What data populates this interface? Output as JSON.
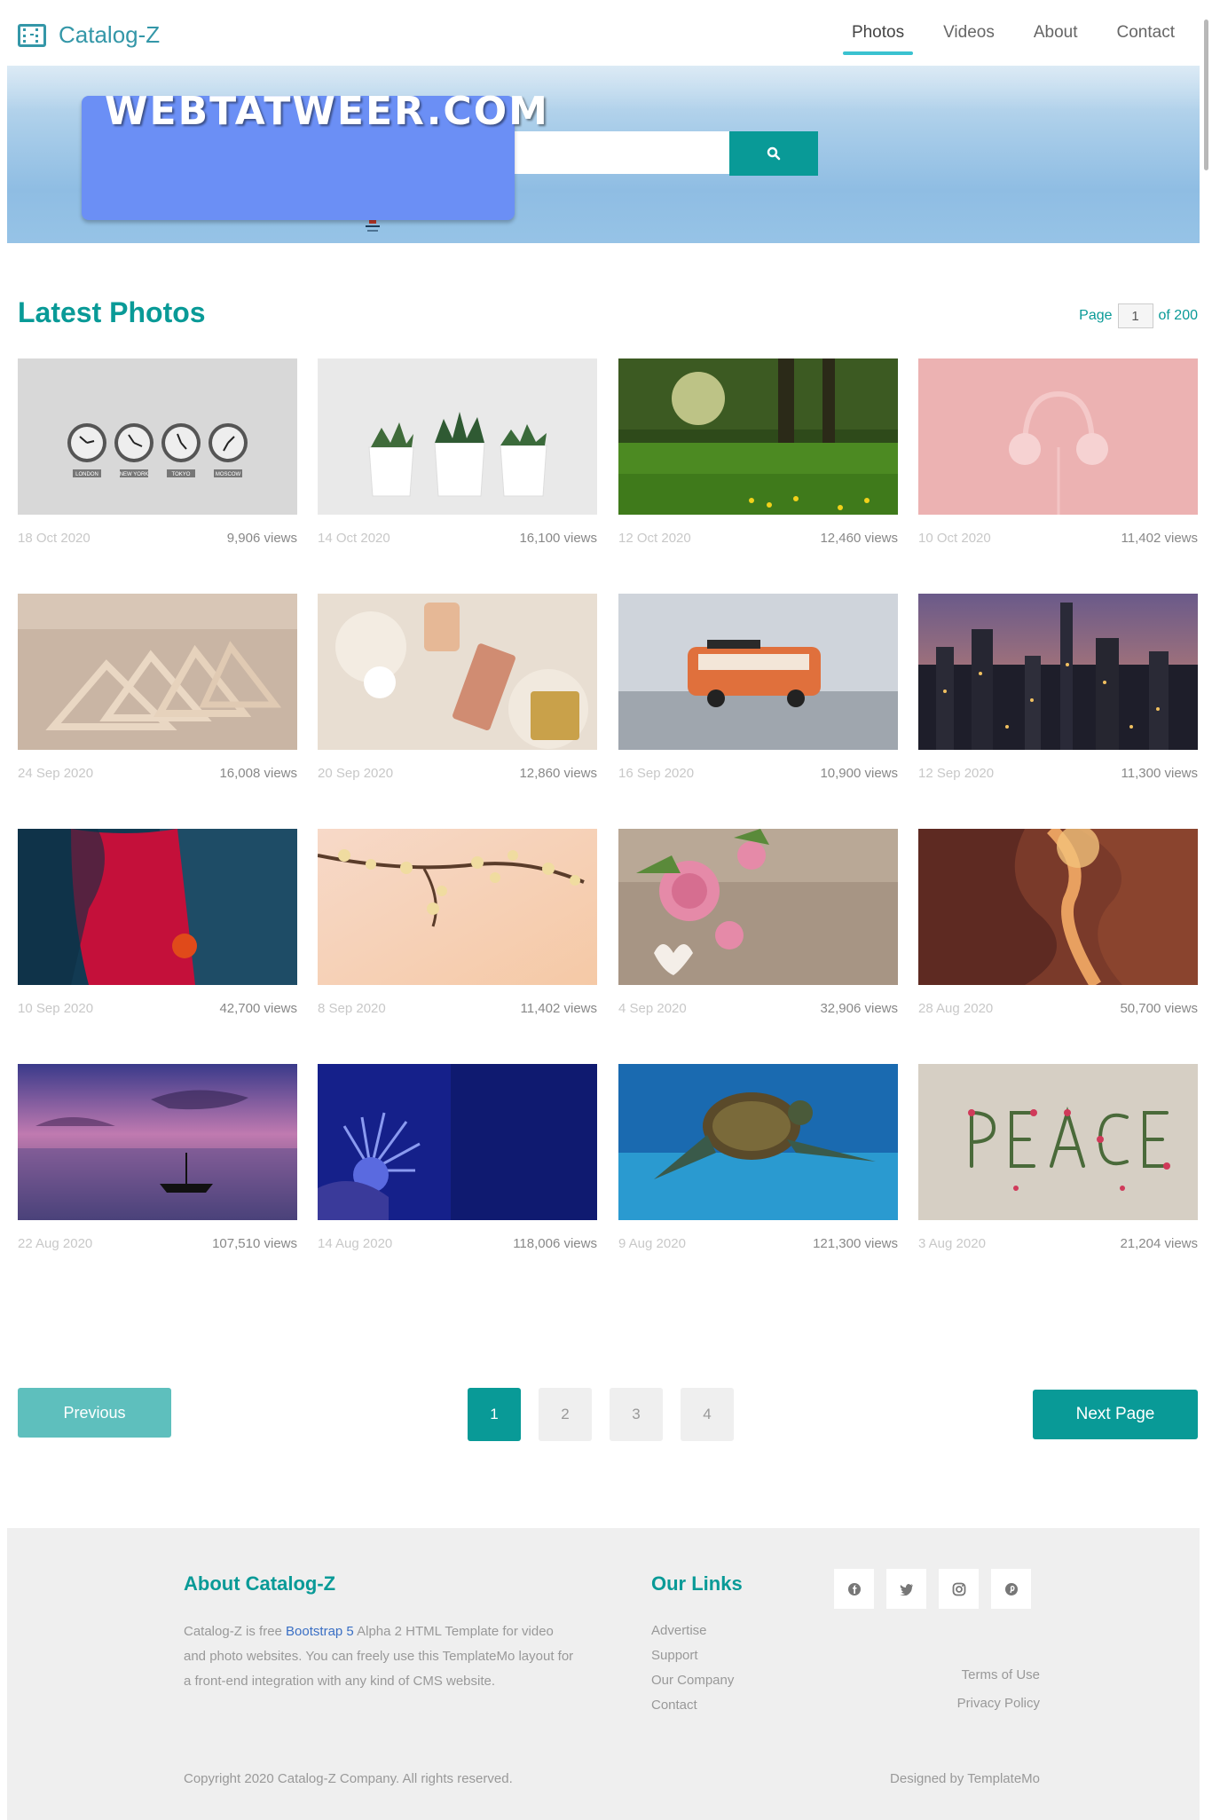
{
  "brand": {
    "name": "Catalog-Z"
  },
  "nav": [
    "Photos",
    "Videos",
    "About",
    "Contact"
  ],
  "hero": {
    "overlay_text": "WEBTATWEER.COM",
    "search_placeholder": ""
  },
  "section": {
    "title": "Latest Photos",
    "page_label": "Page",
    "page_value": "1",
    "page_of": "of 200"
  },
  "photos": [
    {
      "date": "18 Oct 2020",
      "views": "9,906 views"
    },
    {
      "date": "14 Oct 2020",
      "views": "16,100 views"
    },
    {
      "date": "12 Oct 2020",
      "views": "12,460 views"
    },
    {
      "date": "10 Oct 2020",
      "views": "11,402 views"
    },
    {
      "date": "24 Sep 2020",
      "views": "16,008 views"
    },
    {
      "date": "20 Sep 2020",
      "views": "12,860 views"
    },
    {
      "date": "16 Sep 2020",
      "views": "10,900 views"
    },
    {
      "date": "12 Sep 2020",
      "views": "11,300 views"
    },
    {
      "date": "10 Sep 2020",
      "views": "42,700 views"
    },
    {
      "date": "8 Sep 2020",
      "views": "11,402 views"
    },
    {
      "date": "4 Sep 2020",
      "views": "32,906 views"
    },
    {
      "date": "28 Aug 2020",
      "views": "50,700 views"
    },
    {
      "date": "22 Aug 2020",
      "views": "107,510 views"
    },
    {
      "date": "14 Aug 2020",
      "views": "118,006 views"
    },
    {
      "date": "9 Aug 2020",
      "views": "121,300 views"
    },
    {
      "date": "3 Aug 2020",
      "views": "21,204 views"
    }
  ],
  "clock_labels": [
    "LONDON",
    "NEW YORK",
    "TOKYO",
    "MOSCOW"
  ],
  "pagination": {
    "previous": "Previous",
    "pages": [
      "1",
      "2",
      "3",
      "4"
    ],
    "next": "Next Page"
  },
  "footer": {
    "about_title": "About Catalog-Z",
    "about_pre": "Catalog-Z is free ",
    "about_link": "Bootstrap 5",
    "about_post": " Alpha 2 HTML Template for video and photo websites. You can freely use this TemplateMo layout for a front-end integration with any kind of CMS website.",
    "links_title": "Our Links",
    "links": [
      "Advertise",
      "Support",
      "Our Company",
      "Contact"
    ],
    "terms": "Terms of Use",
    "privacy": "Privacy Policy",
    "copyright": "Copyright 2020 Catalog-Z Company. All rights reserved.",
    "designed": "Designed by TemplateMo"
  },
  "colors": {
    "accent": "#099a97",
    "brand": "#3497a8",
    "overlay": "#6b8ff5"
  },
  "icons": [
    "film-icon",
    "search-icon",
    "facebook-icon",
    "twitter-icon",
    "instagram-icon",
    "pinterest-icon"
  ]
}
